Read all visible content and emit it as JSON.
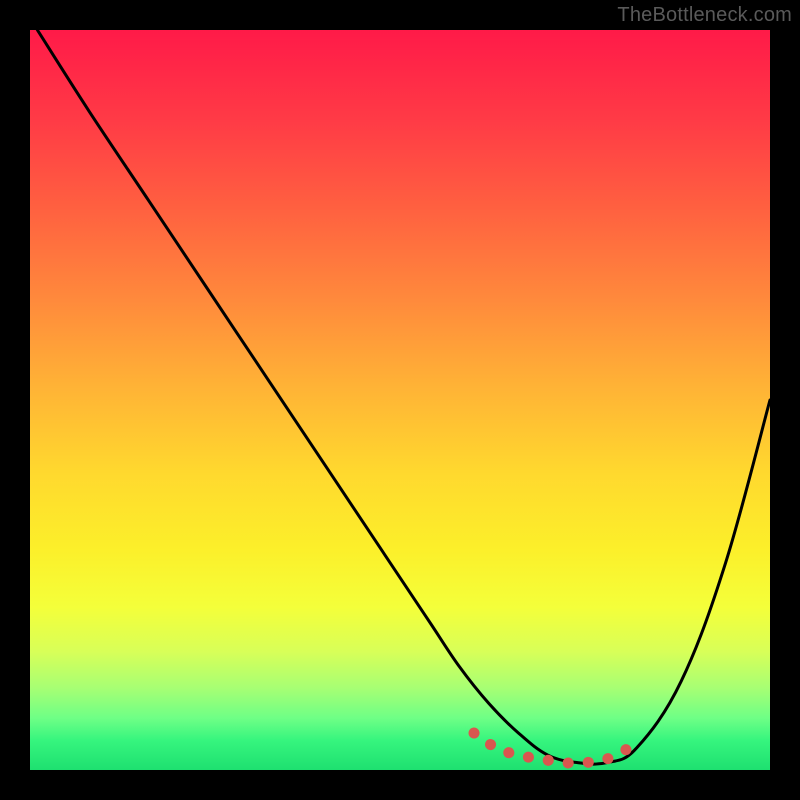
{
  "watermark": "TheBottleneck.com",
  "chart_data": {
    "type": "line",
    "title": "",
    "xlabel": "",
    "ylabel": "",
    "xlim": [
      0,
      100
    ],
    "ylim": [
      0,
      100
    ],
    "grid": false,
    "legend": false,
    "background_gradient": {
      "top": "#ff1a48",
      "mid": "#ffd92e",
      "bottom": "#1ee070"
    },
    "series": [
      {
        "name": "bottleneck-curve",
        "color": "#000000",
        "x": [
          1,
          8,
          16,
          24,
          32,
          40,
          48,
          54,
          58,
          62,
          66,
          70,
          74,
          78,
          82,
          88,
          94,
          100
        ],
        "values": [
          100,
          89,
          77,
          65,
          53,
          41,
          29,
          20,
          14,
          9,
          5,
          2,
          1,
          1,
          3,
          12,
          28,
          50
        ]
      }
    ],
    "highlight": {
      "name": "optimal-range-dots",
      "color": "#d9574f",
      "x": [
        60,
        63,
        66,
        69,
        72,
        75,
        78,
        81
      ],
      "values": [
        5,
        3,
        2,
        1.5,
        1,
        1,
        1.5,
        3
      ]
    }
  }
}
